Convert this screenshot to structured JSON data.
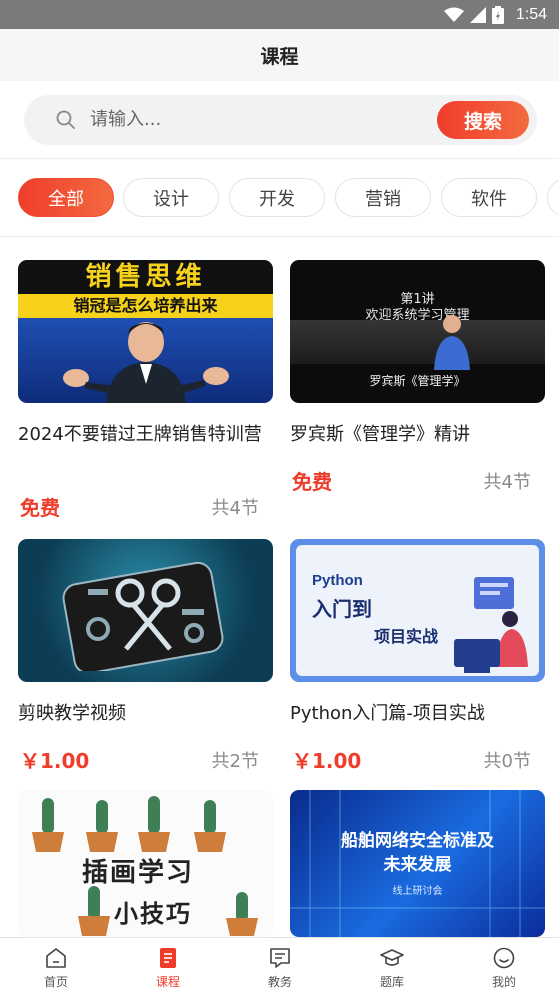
{
  "status_bar": {
    "time": "1:54"
  },
  "header": {
    "title": "课程"
  },
  "search": {
    "placeholder": "请输入...",
    "button_label": "搜索"
  },
  "categories": [
    {
      "label": "全部",
      "active": true
    },
    {
      "label": "设计",
      "active": false
    },
    {
      "label": "开发",
      "active": false
    },
    {
      "label": "营销",
      "active": false
    },
    {
      "label": "软件",
      "active": false
    }
  ],
  "courses": [
    {
      "title": "2024不要错过王牌销售特训营",
      "price": "免费",
      "lessons": "共4节",
      "thumb_text": {
        "headline": "销售思维",
        "subline": "销冠是怎么培养出来"
      }
    },
    {
      "title": "罗宾斯《管理学》精讲",
      "price": "免费",
      "lessons": "共4节",
      "thumb_text": {
        "line1": "第1讲",
        "line2": "欢迎系统学习管理",
        "line3": "罗宾斯《管理学》"
      }
    },
    {
      "title": "剪映教学视频",
      "price": "￥1.00",
      "lessons": "共2节",
      "thumb_text": {}
    },
    {
      "title": "Python入门篇-项目实战",
      "price": "￥1.00",
      "lessons": "共0节",
      "thumb_text": {
        "line1": "Python",
        "line2": "入门到",
        "line3": "项目实战"
      }
    },
    {
      "title": "",
      "price": "",
      "lessons": "",
      "thumb_text": {
        "line1": "插画学习",
        "line2": "小技巧"
      }
    },
    {
      "title": "",
      "price": "",
      "lessons": "",
      "thumb_text": {
        "line1": "船舶网络安全标准及",
        "line2": "未来发展",
        "line3": "线上研讨会"
      }
    }
  ],
  "bottom_nav": [
    {
      "label": "首页",
      "icon": "home-icon",
      "active": false
    },
    {
      "label": "课程",
      "icon": "course-icon",
      "active": true
    },
    {
      "label": "教务",
      "icon": "message-icon",
      "active": false
    },
    {
      "label": "题库",
      "icon": "graduation-cap-icon",
      "active": false
    },
    {
      "label": "我的",
      "icon": "smiley-icon",
      "active": false
    }
  ],
  "colors": {
    "accent": "#ee3b2a",
    "accent_light": "#f36a3f",
    "status_bar": "#7a7a7a"
  }
}
